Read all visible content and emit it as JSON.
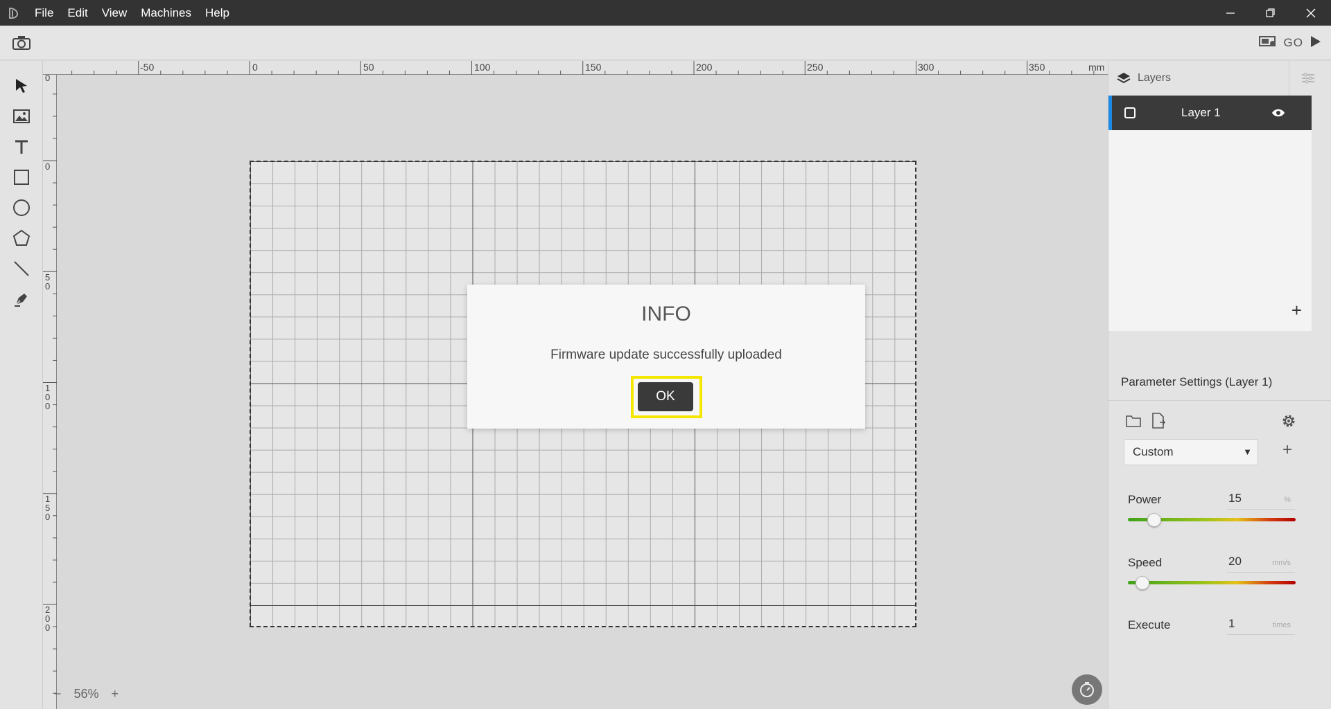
{
  "menu": {
    "items": [
      "File",
      "Edit",
      "View",
      "Machines",
      "Help"
    ]
  },
  "window_controls": [
    "minimize-icon",
    "restore-icon",
    "close-icon"
  ],
  "toolbar": {
    "go_label": "GO"
  },
  "tools": [
    "cursor-icon",
    "image-icon",
    "text-icon",
    "rectangle-icon",
    "ellipse-icon",
    "polygon-icon",
    "line-icon",
    "pen-icon"
  ],
  "ruler": {
    "unit": "mm",
    "x_ticks": [
      "-50",
      "0",
      "50",
      "100",
      "150",
      "200",
      "250",
      "300",
      "350"
    ],
    "y_ticks": [
      "0",
      "0",
      "50",
      "100",
      "150",
      "200"
    ]
  },
  "zoom": {
    "minus": "−",
    "level": "56%",
    "plus": "+"
  },
  "layers": {
    "title": "Layers",
    "items": [
      {
        "name": "Layer 1"
      }
    ],
    "add_label": "+"
  },
  "params": {
    "title": "Parameter Settings (Layer 1)",
    "preset": "Custom",
    "add_label": "+",
    "power": {
      "label": "Power",
      "value": "15",
      "unit": "%",
      "level": 0.14
    },
    "speed": {
      "label": "Speed",
      "value": "20",
      "unit": "mm/s",
      "level": 0.07
    },
    "execute": {
      "label": "Execute",
      "value": "1",
      "unit": "times"
    }
  },
  "dialog": {
    "title": "INFO",
    "message": "Firmware update successfully uploaded",
    "ok_label": "OK"
  },
  "colors": {
    "titlebar": "#333333",
    "layer_selected": "#3a3a3a",
    "layer_accent": "#1e88e5",
    "highlight": "#f5e600"
  }
}
